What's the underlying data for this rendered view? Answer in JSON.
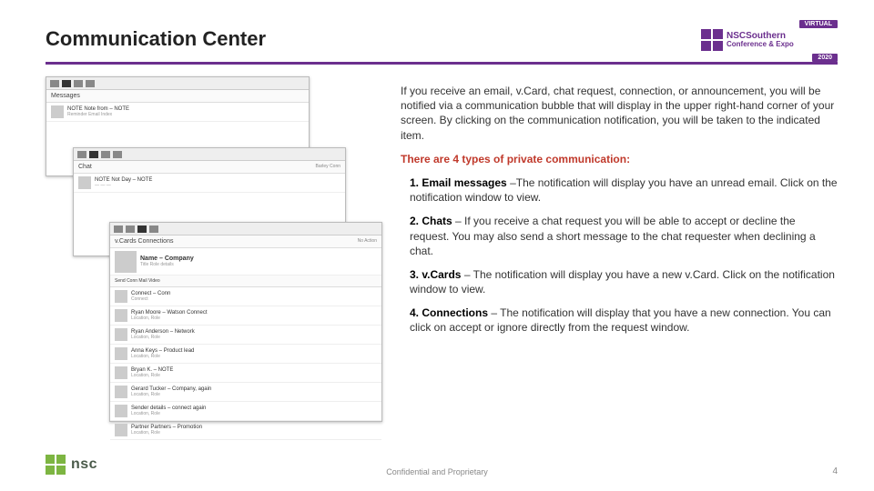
{
  "header": {
    "title": "Communication Center",
    "logo": {
      "badge_top": "VIRTUAL",
      "line1": "NSCSouthern",
      "line2": "Conference & Expo",
      "badge_year": "2020"
    }
  },
  "panels": {
    "p1": {
      "section": "Messages",
      "row_title": "NOTE Note from – NOTE",
      "row_sub": "Reminder  Email  Index"
    },
    "p2": {
      "section": "Chat",
      "row_title": "NOTE Not Day – NOTE",
      "row_sub": "— — —",
      "right": "Barley Conn"
    },
    "p3": {
      "tab": "v.Cards   Connections",
      "right": "No Action",
      "big_title": "Name – Company",
      "big_sub": "Title  Role details",
      "filter": "Send Conn  Mail  Video",
      "rows": [
        {
          "t1": "Connect – Conn",
          "t2": "Connect"
        },
        {
          "t1": "Ryan Moore – Watson Connect",
          "t2": "Location, Role"
        },
        {
          "t1": "Ryan Anderson – Network",
          "t2": "Location, Role"
        },
        {
          "t1": "Anna Keys – Product lead",
          "t2": "Location, Role"
        },
        {
          "t1": "Bryan K. – NOTE",
          "t2": "Location, Role"
        },
        {
          "t1": "Gerard Tucker – Company, again",
          "t2": "Location, Role"
        },
        {
          "t1": "Sender details – connect again",
          "t2": "Location, Role"
        },
        {
          "t1": "Partner Partners – Promotion",
          "t2": "Location, Role"
        }
      ]
    }
  },
  "body": {
    "intro": "If you receive an email, v.Card, chat request, connection, or announcement, you will be notified via a communication bubble that will display in the upper right-hand corner of your screen. By clicking on the communication notification, you will be taken to the indicated item.",
    "types_heading": "There are 4 types of private communication:",
    "items": [
      {
        "lead": "1. Email messages",
        "text": " –The notification will display you have an unread email. Click on the notification window to view."
      },
      {
        "lead": "2. Chats",
        "text": " – If you receive a chat request you will be able to accept or decline the request. You may also send a short message to the chat requester when declining a chat."
      },
      {
        "lead": "3. v.Cards",
        "text": " – The notification will display you have a new v.Card. Click on the notification window to view."
      },
      {
        "lead": "4. Connections",
        "text": " – The notification will display that you have a new connection. You can click on accept or ignore directly from the request window."
      }
    ]
  },
  "footer": {
    "logo_text": "nsc",
    "center": "Confidential and Proprietary",
    "page": "4"
  }
}
